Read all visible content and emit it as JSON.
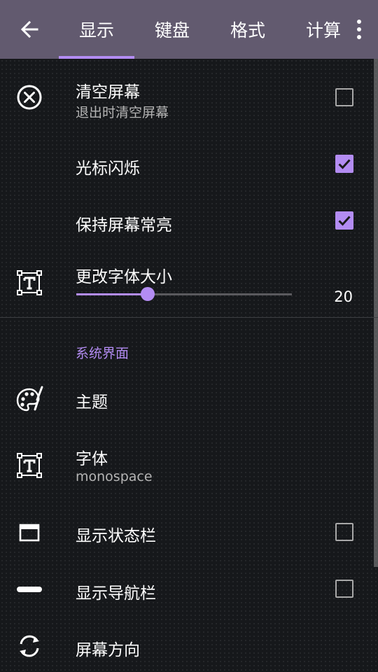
{
  "colors": {
    "toolbar": "#625a6f",
    "accent": "#b38cf2",
    "background": "#16181b"
  },
  "toolbar": {
    "back_icon": "arrow-left-icon",
    "tabs": [
      {
        "label": "显示",
        "active": true
      },
      {
        "label": "键盘",
        "active": false
      },
      {
        "label": "格式",
        "active": false
      },
      {
        "label": "计算",
        "active": false
      }
    ],
    "menu_icon": "more-vertical-icon"
  },
  "settings": {
    "clear_screen": {
      "title": "清空屏幕",
      "subtitle": "退出时清空屏幕",
      "checked": false,
      "icon": "close-circle-icon"
    },
    "cursor_blink": {
      "title": "光标闪烁",
      "checked": true
    },
    "keep_screen_on": {
      "title": "保持屏幕常亮",
      "checked": true
    },
    "font_size": {
      "title": "更改字体大小",
      "value": "20",
      "fraction": 0.33,
      "icon": "text-box-icon"
    }
  },
  "system_ui": {
    "header": "系统界面",
    "theme": {
      "title": "主题",
      "icon": "palette-icon"
    },
    "font": {
      "title": "字体",
      "subtitle": "monospace",
      "icon": "text-box-icon"
    },
    "status_bar": {
      "title": "显示状态栏",
      "checked": false,
      "icon": "window-icon"
    },
    "nav_bar": {
      "title": "显示导航栏",
      "checked": false,
      "icon": "minus-bar-icon"
    },
    "orientation": {
      "title": "屏幕方向",
      "icon": "rotate-icon"
    }
  }
}
